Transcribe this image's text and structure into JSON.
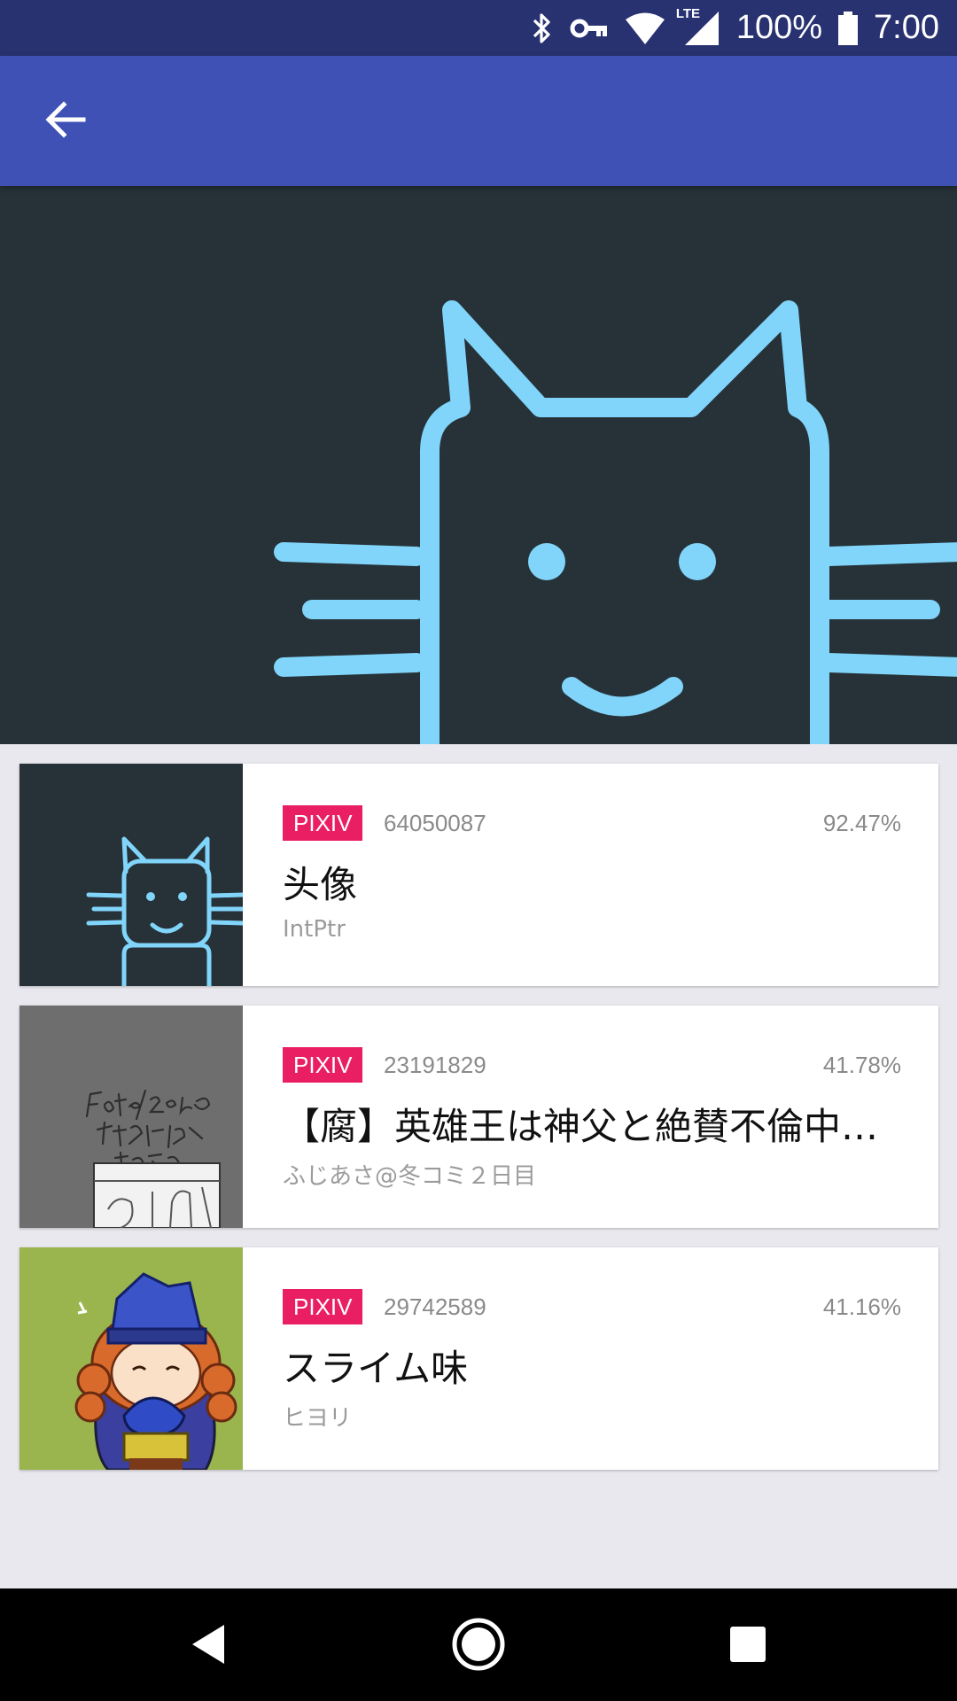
{
  "status_bar": {
    "battery": "100%",
    "time": "7:00",
    "network": "LTE",
    "icons": [
      "bluetooth-icon",
      "vpn-key-icon",
      "wifi-icon",
      "signal-icon",
      "battery-icon"
    ]
  },
  "app_bar": {
    "back_icon": "arrow-back-icon"
  },
  "hero": {
    "image": "cat-logo"
  },
  "results": [
    {
      "source": "PIXIV",
      "id": "64050087",
      "similarity": "92.47%",
      "title": "头像",
      "author": "IntPtr",
      "thumb": "cat-logo-thumbnail"
    },
    {
      "source": "PIXIV",
      "id": "23191829",
      "similarity": "41.78%",
      "title": "【腐】英雄王は神父と絶賛不倫中だ…",
      "author": "ふじあさ@冬コミ２日目",
      "thumb": "sketch-thumbnail"
    },
    {
      "source": "PIXIV",
      "id": "29742589",
      "similarity": "41.16%",
      "title": "スライム味",
      "author": "ヒヨリ",
      "thumb": "chibi-character-thumbnail"
    }
  ],
  "colors": {
    "status_bar": "#283270",
    "app_bar": "#3f51b5",
    "hero_bg": "#263238",
    "cat_stroke": "#81d4fa",
    "badge": "#e91e63",
    "page_bg": "#e9e8ee"
  }
}
